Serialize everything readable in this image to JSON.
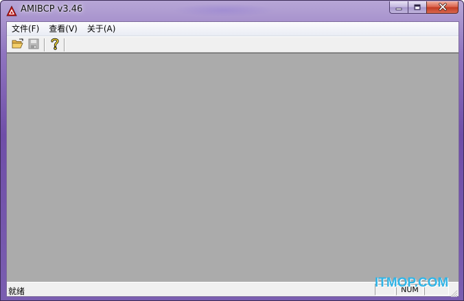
{
  "window": {
    "title": "AMIBCP v3.46",
    "icon": "amibcp-app-icon",
    "caption_buttons": [
      "minimize-icon",
      "maximize-icon",
      "close-icon"
    ]
  },
  "menubar": {
    "items": [
      {
        "label": "文件(F)"
      },
      {
        "label": "查看(V)"
      },
      {
        "label": "关于(A)"
      }
    ]
  },
  "toolbar": {
    "buttons": [
      {
        "icon": "open-folder-icon",
        "enabled": true
      },
      {
        "icon": "save-disk-icon",
        "enabled": false
      },
      {
        "icon": "help-icon",
        "enabled": true
      }
    ]
  },
  "statusbar": {
    "text": "就绪",
    "panes": [
      "",
      "NUM",
      ""
    ]
  },
  "watermark": {
    "text": "ITMOP.COM",
    "color": "#31b4e6"
  },
  "colors": {
    "workspace": "#ababab",
    "chrome": "#f0f0f0",
    "title_gradient": "#7a5eb0"
  }
}
